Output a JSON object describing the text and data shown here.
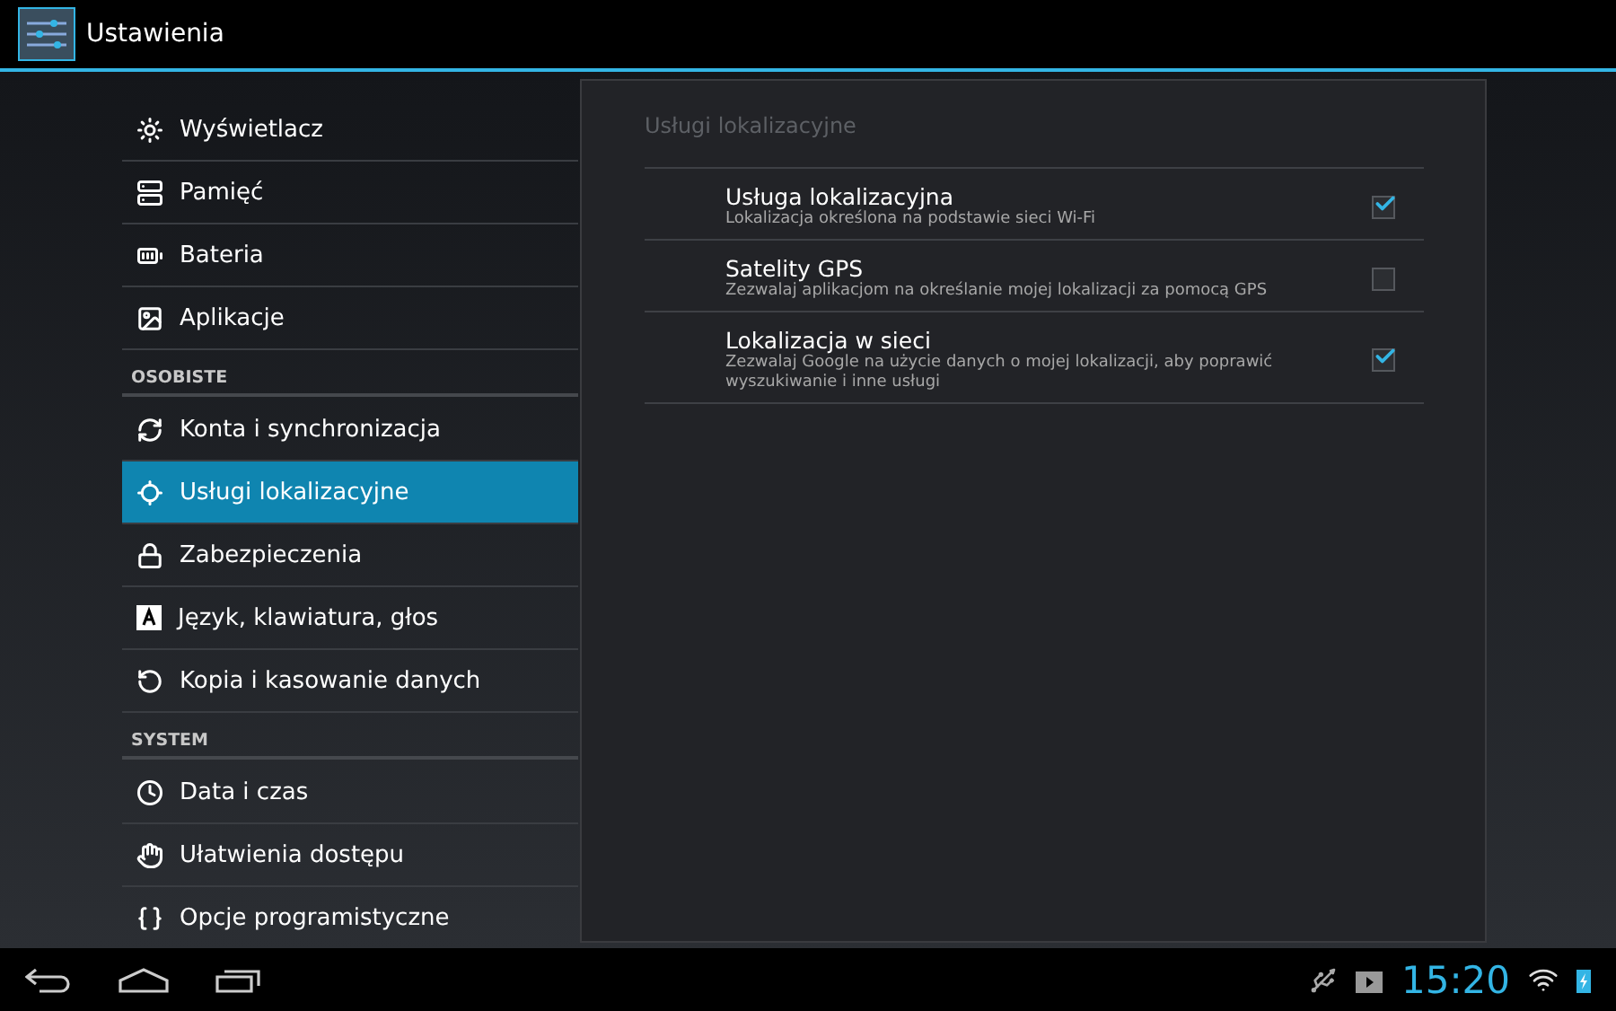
{
  "action_bar": {
    "title": "Ustawienia"
  },
  "sidebar": {
    "items": [
      {
        "kind": "item",
        "label": "Wyświetlacz",
        "selected": false
      },
      {
        "kind": "item",
        "label": "Pamięć",
        "selected": false
      },
      {
        "kind": "item",
        "label": "Bateria",
        "selected": false
      },
      {
        "kind": "item",
        "label": "Aplikacje",
        "selected": false
      },
      {
        "kind": "header",
        "label": "OSOBISTE"
      },
      {
        "kind": "item",
        "label": "Konta i synchronizacja",
        "selected": false
      },
      {
        "kind": "item",
        "label": "Usługi lokalizacyjne",
        "selected": true
      },
      {
        "kind": "item",
        "label": "Zabezpieczenia",
        "selected": false
      },
      {
        "kind": "item",
        "label": "Język, klawiatura, głos",
        "selected": false
      },
      {
        "kind": "item",
        "label": "Kopia i kasowanie danych",
        "selected": false
      },
      {
        "kind": "header",
        "label": "SYSTEM"
      },
      {
        "kind": "item",
        "label": "Data i czas",
        "selected": false
      },
      {
        "kind": "item",
        "label": "Ułatwienia dostępu",
        "selected": false
      },
      {
        "kind": "item",
        "label": "Opcje programistyczne",
        "selected": false
      }
    ]
  },
  "panel": {
    "title": "Usługi lokalizacyjne",
    "settings": [
      {
        "title": "Usługa lokalizacyjna",
        "summary": "Lokalizacja określona na podstawie sieci Wi-Fi",
        "checked": true
      },
      {
        "title": "Satelity GPS",
        "summary": "Zezwalaj aplikacjom na określanie mojej lokalizacji za pomocą GPS",
        "checked": false
      },
      {
        "title": "Lokalizacja w sieci",
        "summary": "Zezwalaj Google na użycie danych o mojej lokalizacji, aby poprawić wyszukiwanie i inne usługi",
        "checked": true
      }
    ]
  },
  "status_bar": {
    "time": "15:20"
  }
}
